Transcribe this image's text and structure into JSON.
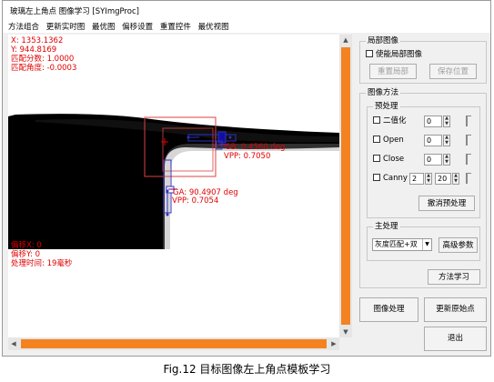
{
  "window": {
    "title": "玻璃左上角点 图像学习 [SYImgProc]"
  },
  "menu": {
    "items": [
      "方法组合",
      "更新实时图",
      "最优图",
      "偏移设置",
      "重置控件",
      "最优视图"
    ]
  },
  "overlay": {
    "x_label": "X: 1353.1362",
    "y_label": "Y: 944.8169",
    "score_label": "匹配分数: 1.0000",
    "angle_label": "匹配角度: -0.0003",
    "offset_x_label": "偏移X: 0",
    "offset_y_label": "偏移Y: 0",
    "time_label": "处理时间: 19毫秒",
    "gb_label": "GB: 0.4560 deg",
    "gb_vpp_label": "VPP: 0.7050",
    "ga_label": "GA: 90.4907 deg",
    "ga_vpp_label": "VPP: 0.7054"
  },
  "colors": {
    "scrollbar_thumb": "#f58220",
    "overlay_text": "#e00000",
    "box_red": "#e04040",
    "box_blue": "#3030c0"
  },
  "local_image": {
    "title": "局部图像",
    "enable_label": "使能局部图像",
    "reset_button": "重置局部",
    "save_button": "保存位置"
  },
  "image_method": {
    "title": "图像方法",
    "preprocess": {
      "title": "预处理",
      "rows": [
        {
          "label": "二值化",
          "value": "0"
        },
        {
          "label": "Open",
          "value": "0"
        },
        {
          "label": "Close",
          "value": "0"
        },
        {
          "label": "Canny",
          "value": "2",
          "value2": "20"
        }
      ],
      "cancel_button": "撤消预处理"
    },
    "main": {
      "title": "主处理",
      "combo_value": "灰度匹配+双",
      "params_button": "高级参数",
      "learn_button": "方法学习"
    }
  },
  "buttons": {
    "process": "图像处理",
    "update_origin": "更新原始点",
    "exit": "退出"
  },
  "caption": "Fig.12 目标图像左上角点模板学习"
}
